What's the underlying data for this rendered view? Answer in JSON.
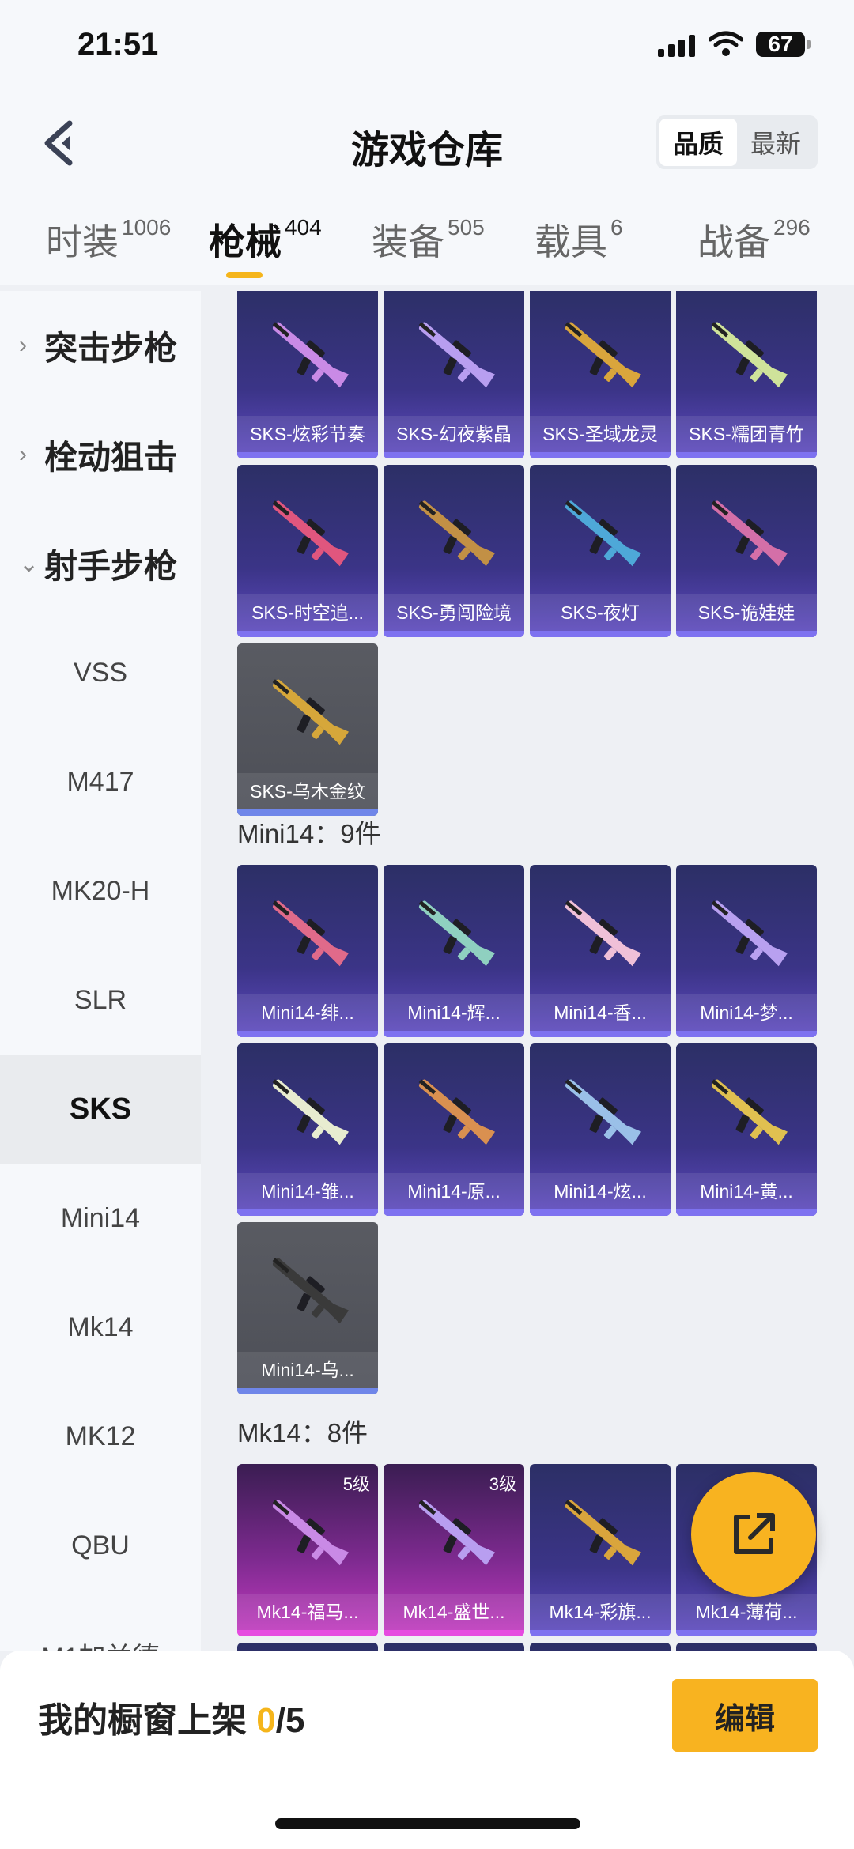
{
  "status_bar": {
    "time": "21:51",
    "battery": "67"
  },
  "header": {
    "title": "游戏仓库",
    "sort_options": [
      "品质",
      "最新"
    ],
    "sort_selected": "品质"
  },
  "tabs": [
    {
      "label": "时装",
      "count": "1006"
    },
    {
      "label": "枪械",
      "count": "404"
    },
    {
      "label": "装备",
      "count": "505"
    },
    {
      "label": "载具",
      "count": "6"
    },
    {
      "label": "战备",
      "count": "296"
    }
  ],
  "active_tab": "枪械",
  "sidebar": {
    "categories": [
      {
        "label": "突击步枪",
        "state": "collapsed"
      },
      {
        "label": "栓动狙击",
        "state": "collapsed"
      },
      {
        "label": "射手步枪",
        "state": "expanded"
      }
    ],
    "items": [
      "VSS",
      "M417",
      "MK20-H",
      "SLR",
      "SKS",
      "Mini14",
      "Mk14",
      "MK12",
      "QBU",
      "M1加兰德"
    ],
    "selected": "SKS"
  },
  "sections": [
    {
      "title": "",
      "items": [
        {
          "name": "SKS-炫彩节奏"
        },
        {
          "name": "SKS-幻夜紫晶"
        },
        {
          "name": "SKS-圣域龙灵"
        },
        {
          "name": "SKS-糯团青竹"
        },
        {
          "name": "SKS-时空追..."
        },
        {
          "name": "SKS-勇闯险境"
        },
        {
          "name": "SKS-夜灯"
        },
        {
          "name": "SKS-诡娃娃"
        },
        {
          "name": "SKS-乌木金纹"
        }
      ]
    },
    {
      "title": "Mini14：9件",
      "items": [
        {
          "name": "Mini14-绯..."
        },
        {
          "name": "Mini14-辉..."
        },
        {
          "name": "Mini14-香..."
        },
        {
          "name": "Mini14-梦..."
        },
        {
          "name": "Mini14-雏..."
        },
        {
          "name": "Mini14-原..."
        },
        {
          "name": "Mini14-炫..."
        },
        {
          "name": "Mini14-黄..."
        },
        {
          "name": "Mini14-乌..."
        }
      ]
    },
    {
      "title": "Mk14：8件",
      "items": [
        {
          "name": "Mk14-福马...",
          "level": "5级"
        },
        {
          "name": "Mk14-盛世...",
          "level": "3级"
        },
        {
          "name": "Mk14-彩旗..."
        },
        {
          "name": "Mk14-薄荷..."
        }
      ]
    }
  ],
  "bottom_bar": {
    "label": "我的橱窗上架",
    "listed": "0",
    "separator": "/",
    "total": "5",
    "edit_label": "编辑"
  },
  "colors": {
    "accent": "#f8b320",
    "card_purple": "#3b3487",
    "card_pink": "#c33bc0",
    "card_grey": "#595b62"
  }
}
